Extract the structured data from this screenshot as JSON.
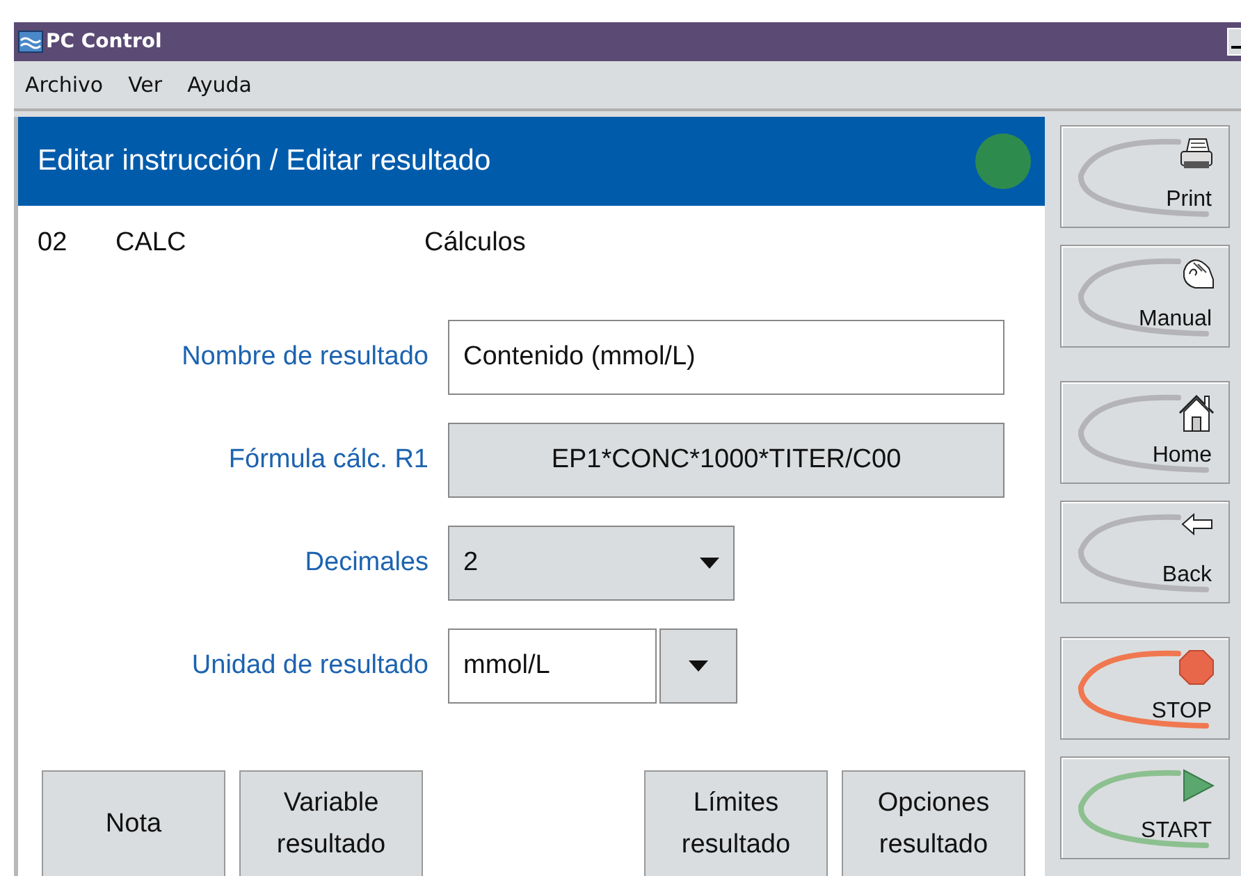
{
  "window": {
    "title": "PC Control"
  },
  "menu": [
    "Archivo",
    "Ver",
    "Ayuda"
  ],
  "header": {
    "title": "Editar instrucción / Editar resultado",
    "color": "#2e8b4e"
  },
  "method_row": {
    "number": "02",
    "code": "CALC",
    "name": "Cálculos"
  },
  "fields": [
    {
      "kind": "text",
      "label": "Nombre de resultado",
      "value": "Contenido (mmol/L)"
    },
    {
      "kind": "button",
      "label": "Fórmula cálc. R1",
      "value": "EP1*CONC*1000*TITER/C00"
    },
    {
      "kind": "dropdown",
      "label": "Decimales",
      "value": "2"
    },
    {
      "kind": "combo",
      "label": "Unidad de resultado",
      "value": "mmol/L"
    }
  ],
  "left_buttons": [
    "Nota",
    "Variable resultado"
  ],
  "right_buttons": [
    "Límites resultado",
    "Opciones resultado"
  ],
  "sidebar": [
    {
      "label": "Print",
      "kind": "printer",
      "color": "#b4b4b8"
    },
    {
      "label": "Manual",
      "kind": "hand",
      "color": "#b4b4b8"
    },
    {
      "label": "Home",
      "kind": "house",
      "color": "#b4b4b8"
    },
    {
      "label": "Back",
      "kind": "arrow",
      "color": "#b4b4b8"
    },
    {
      "label": "STOP",
      "kind": "stop",
      "color": "#f07850"
    },
    {
      "label": "START",
      "kind": "start",
      "color": "#8cc090"
    }
  ]
}
